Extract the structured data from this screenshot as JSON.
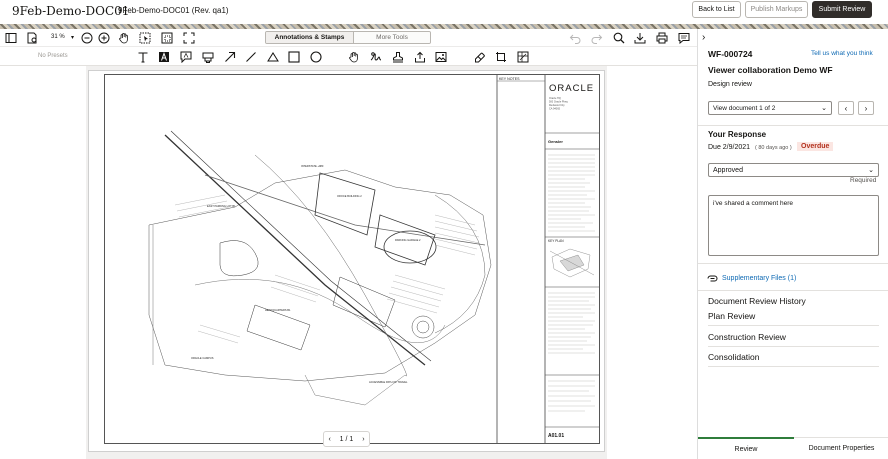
{
  "header": {
    "title": "9Feb-Demo-DOC01",
    "subtitle": "9Feb-Demo-DOC01 (Rev. qa1)",
    "back_label": "Back to List",
    "publish_label": "Publish Markups",
    "submit_label": "Submit Review"
  },
  "toolbar": {
    "zoom": "31",
    "zoom_unit": "%",
    "tab_annotations": "Annotations & Stamps",
    "tab_more_tools": "More Tools",
    "presets": "No Presets",
    "icons_left": [
      "toggle-thumbnails-icon",
      "page-settings-icon",
      "zoom-out-icon",
      "zoom-in-icon",
      "pan-hand-icon",
      "select-text-icon",
      "area-select-icon",
      "fit-screen-icon"
    ],
    "icons_right": [
      "undo-icon",
      "redo-icon",
      "search-icon",
      "download-icon",
      "print-icon",
      "comments-icon"
    ],
    "markup_icons": [
      "text-tool-icon",
      "text-box-icon",
      "callout-icon",
      "stamp-icon",
      "arrow-tool-icon",
      "line-tool-icon",
      "cloud-tool-icon",
      "rectangle-tool-icon",
      "ellipse-tool-icon",
      "hand-tool-icon",
      "signature-icon",
      "stamp-tool-icon",
      "upload-stamp-icon",
      "image-tool-icon",
      "eraser-tool-icon",
      "measure-icon",
      "compare-icon"
    ]
  },
  "viewer": {
    "page_current": "1",
    "page_total": "1",
    "page_separator": "/",
    "sheet": {
      "key_notes": "KEY NOTES",
      "logo": "ORACLE",
      "address": [
        "Oracle HQ",
        "500 Oracle Pkwy",
        "Redwood City",
        "CA 94065"
      ],
      "firm": "Gensler",
      "key_plan": "KEY PLAN",
      "sheet_number": "A01.01",
      "labels": {
        "east_parking": "EAST PARKING LOT B1",
        "office_building": "OFFICE BUILDING 2",
        "parking_garage": "PARKING GARAGE 2",
        "interstate": "INTERSTATE +980",
        "hq": "HEADQUARTERS B1",
        "campus": "ORACLE CAMPUS",
        "accessible_path": "ACCESSIBLE PATH OF TRAVEL"
      }
    }
  },
  "panel": {
    "workflow_id": "WF-000724",
    "feedback_link": "Tell us what you think",
    "workflow_name": "Viewer collaboration Demo WF",
    "step": "Design review",
    "view_document": "View document 1 of 2",
    "response_title": "Your Response",
    "due": "Due 2/9/2021",
    "days_ago": "( 80 days ago )",
    "overdue": "Overdue",
    "status": "Approved",
    "required": "Required",
    "comment": "i've shared a comment here",
    "supplementary": "Supplementary Files (1)",
    "history_title": "Document Review History",
    "history": [
      "Plan Review",
      "Construction Review",
      "Consolidation"
    ],
    "tab_review": "Review",
    "tab_properties": "Document Properties"
  },
  "colors": {
    "primary_button": "#312d2a",
    "link": "#0f6ab4",
    "overdue": "#b3311e",
    "active_tab": "#2f7d3b"
  }
}
